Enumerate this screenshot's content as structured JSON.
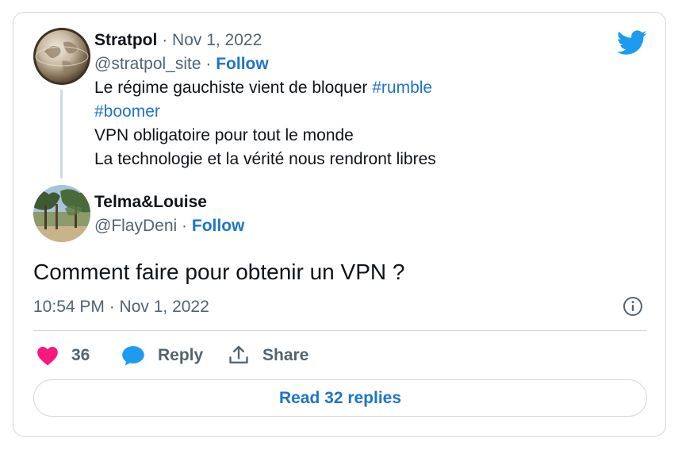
{
  "quoted_tweet": {
    "author_name": "Stratpol",
    "separator": "·",
    "date": "Nov 1, 2022",
    "handle": "@stratpol_site",
    "follow_label": "Follow",
    "lines": [
      {
        "text": "Le régime gauchiste vient de bloquer ",
        "hashtag": "#rumble"
      },
      {
        "text": "",
        "hashtag": "#boomer"
      },
      {
        "text": "VPN obligatoire pour tout le monde",
        "hashtag": ""
      },
      {
        "text": "La technologie et la vérité nous rendront libres",
        "hashtag": ""
      }
    ]
  },
  "reply_tweet": {
    "author_name": "Telma&Louise",
    "handle": "@FlayDeni",
    "separator": "·",
    "follow_label": "Follow",
    "text": "Comment faire pour obtenir un VPN ?",
    "timestamp": "10:54 PM · Nov 1, 2022"
  },
  "actions": {
    "like_count": "36",
    "reply_label": "Reply",
    "share_label": "Share"
  },
  "read_replies_label": "Read 32 replies",
  "icons": {
    "brand": "twitter-bird-icon",
    "info": "info-icon",
    "like": "heart-icon",
    "reply": "speech-bubble-icon",
    "share": "share-icon"
  },
  "colors": {
    "twitter_blue": "#1d9bf0",
    "link_blue": "#1d75c9",
    "heart_pink": "#f91880",
    "muted_text": "#536471",
    "border": "#cfd9de"
  }
}
